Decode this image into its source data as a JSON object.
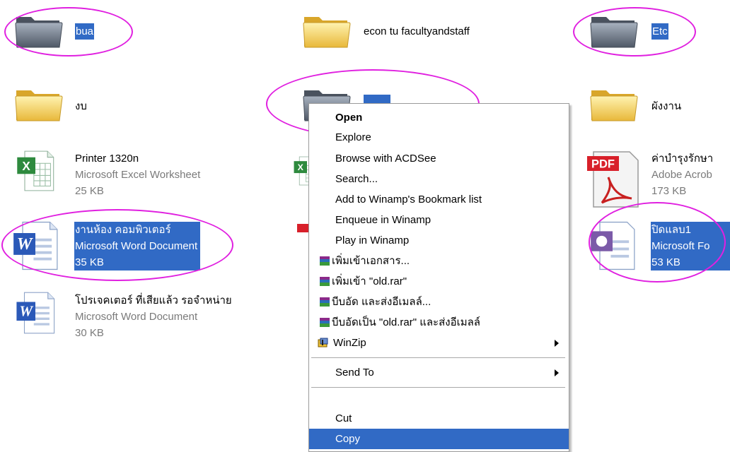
{
  "files": {
    "bua": {
      "name": "bua"
    },
    "econ": {
      "name": "econ tu facultyandstaff"
    },
    "etc": {
      "name": "Etc"
    },
    "ngob": {
      "name": "งบ"
    },
    "selected_folder": {
      "name": "■■■■■"
    },
    "phangngan": {
      "name": "ผังงาน"
    },
    "printer": {
      "name": "Printer 1320n",
      "type": "Microsoft Excel Worksheet",
      "size": "25 KB"
    },
    "pdf": {
      "name": "ค่าบำรุงรักษา",
      "type": "Adobe Acrob",
      "size": "173 KB"
    },
    "ngan_hong": {
      "name": "งานห้อง คอมพิวเตอร์",
      "type": "Microsoft Word Document",
      "size": "35 KB"
    },
    "pidlab": {
      "name": "ปิดแลบ1",
      "type": "Microsoft Fo",
      "size": "53 KB"
    },
    "projector": {
      "name": "โปรเจคเตอร์ ที่เสียแล้ว รอจำหน่าย",
      "type": "Microsoft Word Document",
      "size": "30 KB"
    }
  },
  "context_menu": {
    "open": "Open",
    "explore": "Explore",
    "browse_acdsee": "Browse with ACDSee",
    "search": "Search...",
    "add_winamp_bookmark": "Add to Winamp's Bookmark list",
    "enqueue_winamp": "Enqueue in Winamp",
    "play_winamp": "Play in Winamp",
    "rar_add_archive": "เพิ่มเข้าเอกสาร...",
    "rar_add_old": "เพิ่มเข้า \"old.rar\"",
    "rar_compress_email": "บีบอัด และส่งอีเมลล์...",
    "rar_compress_old_email": "บีบอัดเป็น \"old.rar\" และส่งอีเมลล์",
    "winzip": "WinZip",
    "send_to": "Send To",
    "cut": "Cut",
    "copy": "Copy"
  },
  "icons": {
    "folder": "folder-icon",
    "excel": "excel-document-icon",
    "word": "word-document-icon",
    "pdf": "pdf-document-icon",
    "winrar": "winrar-icon",
    "winzip": "winzip-icon",
    "submenu": "submenu-arrow-icon"
  },
  "colors": {
    "selection": "#316ac5",
    "annotation_circle": "#e020e0",
    "folder_yellow": "#f5d86a",
    "folder_gray": "#76808e"
  }
}
